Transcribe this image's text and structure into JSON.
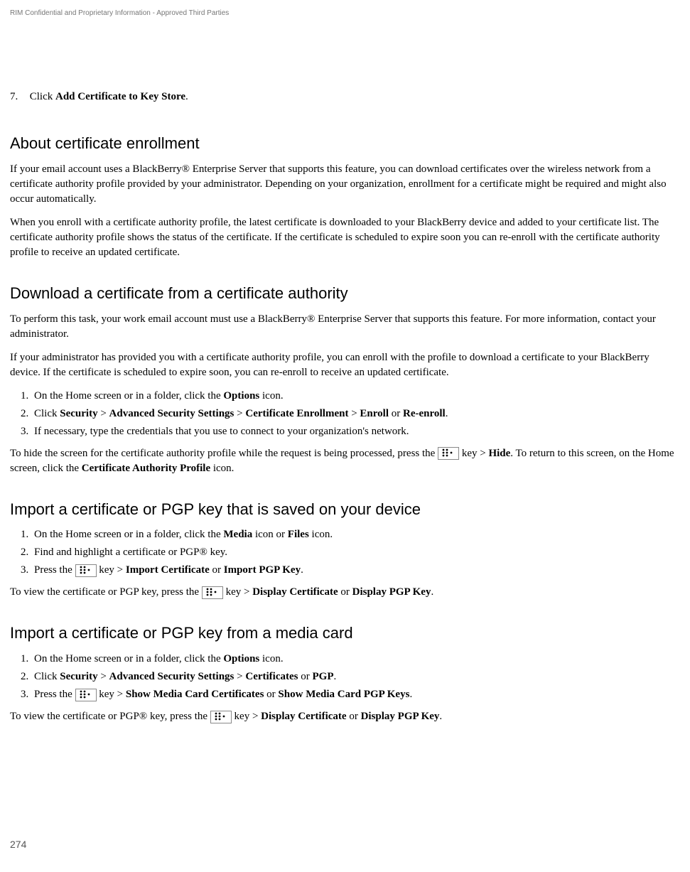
{
  "header": {
    "confidential": "RIM Confidential and Proprietary Information - Approved Third Parties"
  },
  "topStep": {
    "num": "7.",
    "pre": "Click ",
    "bold": "Add Certificate to Key Store",
    "post": "."
  },
  "sect1": {
    "title": "About certificate enrollment",
    "p1": "If your email account uses a BlackBerry® Enterprise Server that supports this feature, you can download certificates over the wireless network from a certificate authority profile provided by your administrator. Depending on your organization, enrollment for a certificate might be required and might also occur automatically.",
    "p2": "When you enroll with a certificate authority profile, the latest certificate is downloaded to your BlackBerry device and added to your certificate list. The certificate authority profile shows the status of the certificate. If the certificate is scheduled to expire soon you can re-enroll with the certificate authority profile to receive an updated certificate."
  },
  "sect2": {
    "title": "Download a certificate from a certificate authority",
    "p1": "To perform this task, your work email account must use a BlackBerry® Enterprise Server that supports this feature. For more information, contact your administrator.",
    "p2": "If your administrator has provided you with a certificate authority profile, you can enroll with the profile to download a certificate to your BlackBerry device. If the certificate is scheduled to expire soon, you can re-enroll to receive an updated certificate.",
    "li1_pre": "On the Home screen or in a folder, click the ",
    "li1_b1": "Options",
    "li1_post": " icon.",
    "li2_pre": "Click ",
    "li2_b1": "Security",
    "li2_sep": " > ",
    "li2_b2": "Advanced Security Settings",
    "li2_b3": "Certificate Enrollment",
    "li2_b4": "Enroll",
    "li2_or": " or ",
    "li2_b5": "Re-enroll",
    "li2_post": ".",
    "li3": "If necessary, type the credentials that you use to connect to your organization's network.",
    "after_pre": "To hide the screen for the certificate authority profile while the request is being processed, press the ",
    "after_key": " key > ",
    "after_b1": "Hide",
    "after_mid": ". To return to this screen, on the Home screen, click the ",
    "after_b2": "Certificate Authority Profile",
    "after_post": " icon."
  },
  "sect3": {
    "title": "Import a certificate or PGP key that is saved on your device",
    "li1_pre": "On the Home screen or in a folder, click the ",
    "li1_b1": "Media",
    "li1_mid": " icon or ",
    "li1_b2": "Files",
    "li1_post": " icon.",
    "li2": "Find and highlight a certificate or PGP® key.",
    "li3_pre": "Press the ",
    "li3_key": " key > ",
    "li3_b1": "Import Certificate",
    "li3_or": " or ",
    "li3_b2": "Import PGP Key",
    "li3_post": ".",
    "after_pre": "To view the certificate or PGP key, press the ",
    "after_key": " key > ",
    "after_b1": "Display Certificate",
    "after_or": " or ",
    "after_b2": "Display PGP Key",
    "after_post": "."
  },
  "sect4": {
    "title": "Import a certificate or PGP key from a media card",
    "li1_pre": "On the Home screen or in a folder, click the ",
    "li1_b1": "Options",
    "li1_post": " icon.",
    "li2_pre": "Click ",
    "li2_b1": "Security",
    "li2_sep": " > ",
    "li2_b2": "Advanced Security Settings",
    "li2_b3": "Certificates",
    "li2_or": " or ",
    "li2_b4": "PGP",
    "li2_post": ".",
    "li3_pre": "Press the ",
    "li3_key": " key > ",
    "li3_b1": "Show Media Card Certificates",
    "li3_or": " or ",
    "li3_b2": "Show Media Card PGP Keys",
    "li3_post": ".",
    "after_pre": "To view the certificate or PGP® key, press the ",
    "after_key": " key > ",
    "after_b1": "Display Certificate",
    "after_or": " or ",
    "after_b2": "Display PGP Key",
    "after_post": "."
  },
  "pageNum": "274"
}
